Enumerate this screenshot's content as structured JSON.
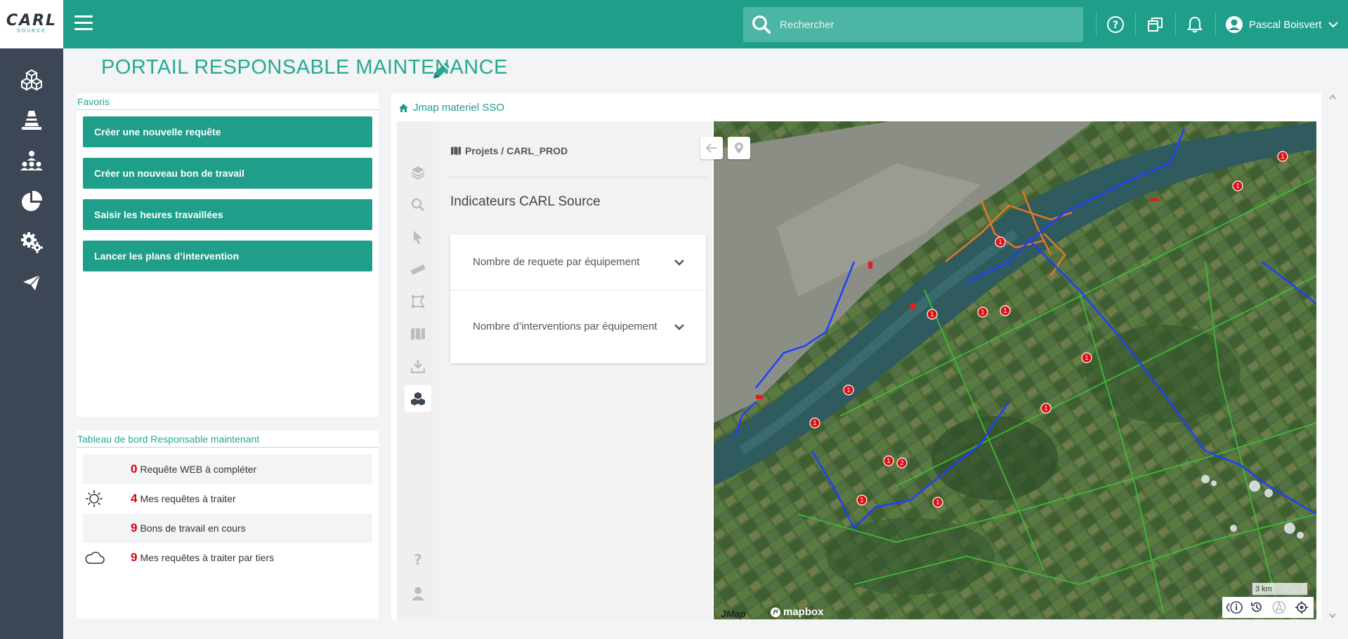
{
  "app": {
    "logo_main": "CARL",
    "logo_sub": "SOURCE"
  },
  "header": {
    "search_placeholder": "Rechercher",
    "user_name": "Pascal Boisvert"
  },
  "page": {
    "title": "PORTAIL RESPONSABLE MAINTENANCE"
  },
  "favoris": {
    "heading": "Favoris",
    "items": [
      {
        "label": "Créer une nouvelle requête"
      },
      {
        "label": "Créer un nouveau bon de travail"
      },
      {
        "label": "Saisir les heures travaillées"
      },
      {
        "label": "Lancer les plans d’intervention"
      }
    ]
  },
  "tableau": {
    "heading": "Tableau de bord Responsable maintenant",
    "rows": [
      {
        "count": "0",
        "label": "Requête WEB à compléter",
        "icon": ""
      },
      {
        "count": "4",
        "label": "Mes requêtes à traiter",
        "icon": "sun-icon"
      },
      {
        "count": "9",
        "label": "Bons de travail en cours",
        "icon": ""
      },
      {
        "count": "9",
        "label": "Mes requêtes à traiter par tiers",
        "icon": "cloud-icon"
      }
    ]
  },
  "map_widget": {
    "breadcrumb": "Jmap materiel SSO",
    "project_path": "Projets / CARL_PROD",
    "indicators_title": "Indicateurs CARL Source",
    "indicators": [
      {
        "label": "Nombre de requete par équipement"
      },
      {
        "label": "Nombre d’interventions par équipement"
      }
    ],
    "scale_label": "3 km",
    "brand": "mapbox",
    "markers": [
      "1",
      "1",
      "1",
      "1",
      "1",
      "1",
      "1",
      "1",
      "1",
      "2",
      "1",
      "1",
      "1",
      "1"
    ]
  },
  "colors": {
    "primary": "#1f9e8a",
    "nav_bg": "#3d4654",
    "alert_red": "#d7000f"
  }
}
